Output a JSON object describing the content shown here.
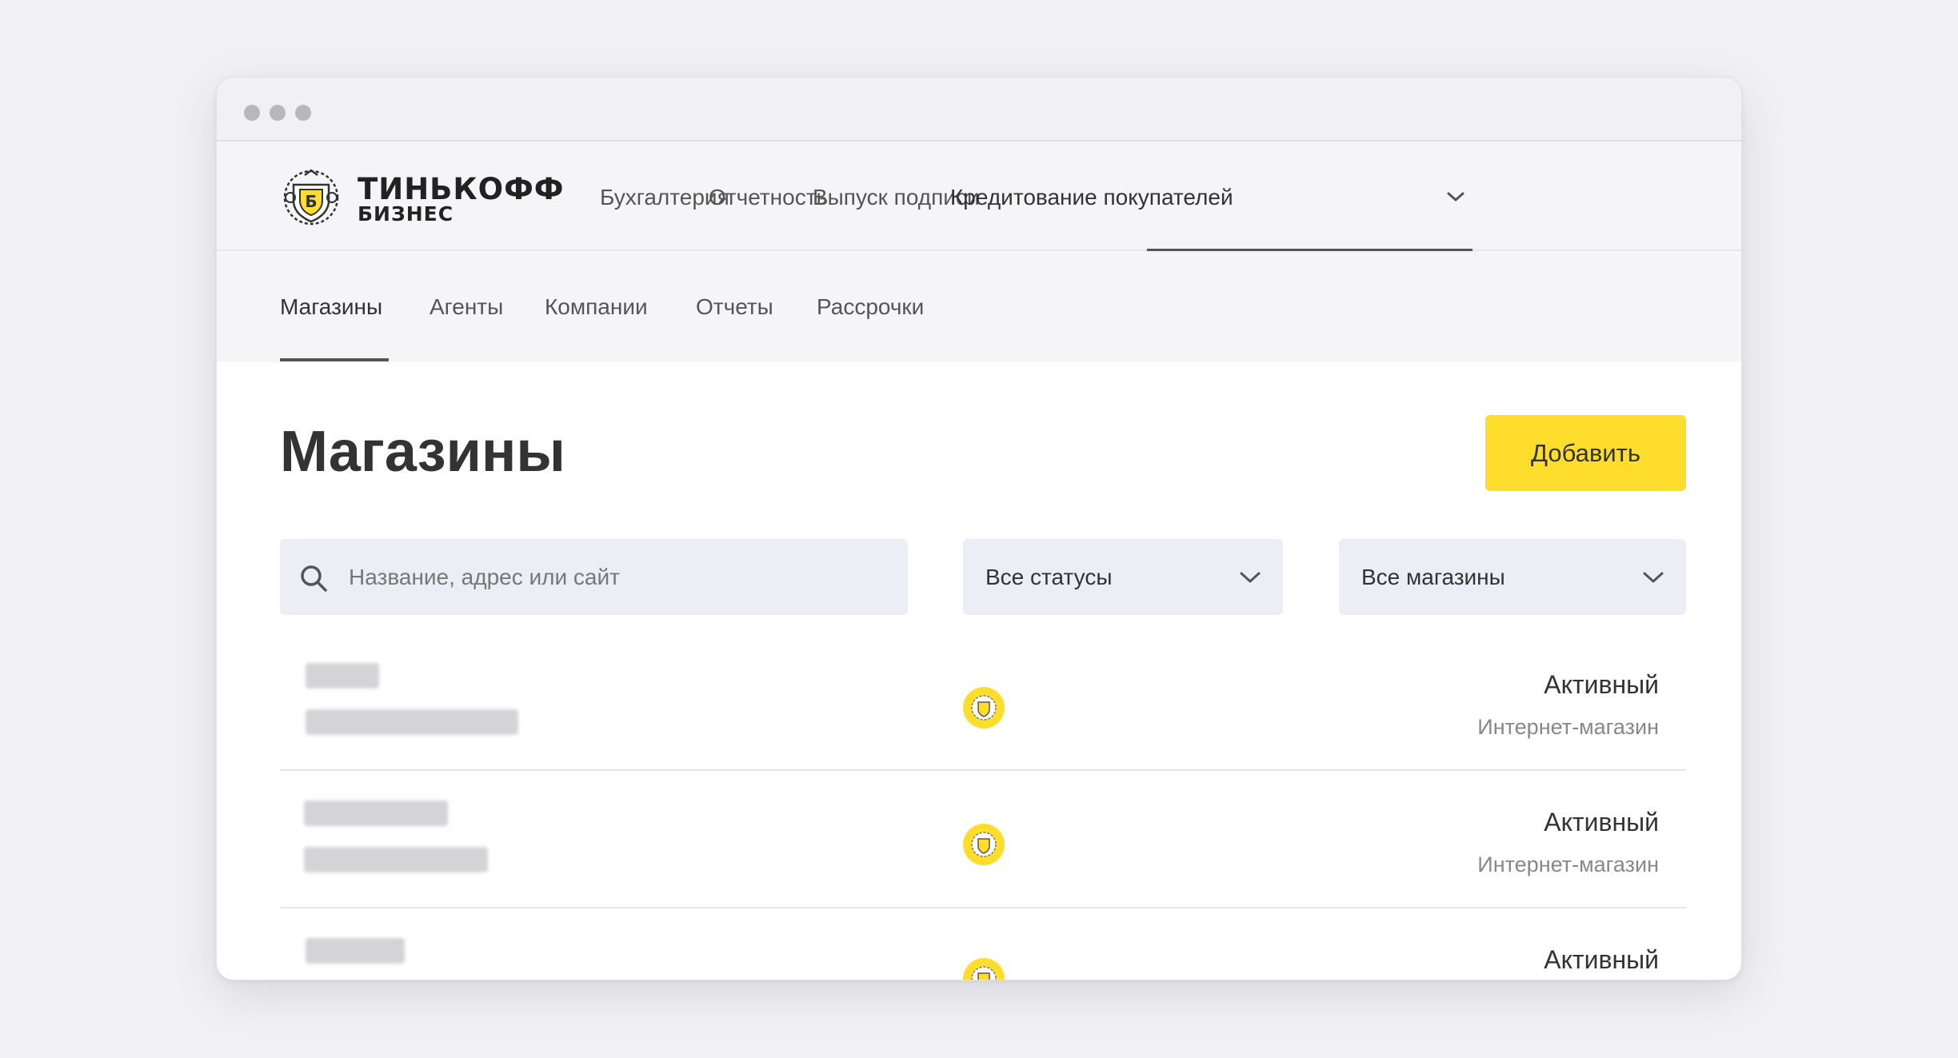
{
  "brand": {
    "name_line1": "ТИНЬКОФФ",
    "name_line2": "БИЗНЕС",
    "accent_color": "#ffdd2d"
  },
  "topnav": {
    "items": [
      {
        "label": "Бухгалтерия"
      },
      {
        "label": "Отчетность"
      },
      {
        "label": "Выпуск подписи"
      },
      {
        "label": "Кредитование покупателей"
      }
    ],
    "active_index": 3
  },
  "subnav": {
    "items": [
      {
        "label": "Магазины"
      },
      {
        "label": "Агенты"
      },
      {
        "label": "Компании"
      },
      {
        "label": "Отчеты"
      },
      {
        "label": "Рассрочки"
      }
    ],
    "active_index": 0
  },
  "page": {
    "title": "Магазины",
    "add_button": "Добавить"
  },
  "filters": {
    "search_placeholder": "Название, адрес или сайт",
    "search_value": "",
    "status_select": "Все статусы",
    "shops_select": "Все магазины"
  },
  "rows": [
    {
      "status": "Активный",
      "type": "Интернет-магазин",
      "icon": "tinkoff-emblem-icon"
    },
    {
      "status": "Активный",
      "type": "Интернет-магазин",
      "icon": "tinkoff-emblem-icon"
    },
    {
      "status": "Активный",
      "type": "",
      "icon": "tinkoff-emblem-icon"
    }
  ]
}
